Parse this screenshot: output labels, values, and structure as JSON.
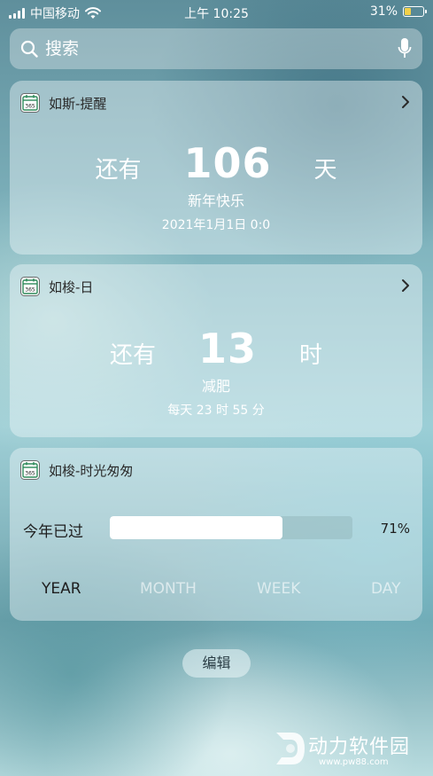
{
  "status_bar": {
    "carrier": "中国移动",
    "time": "上午 10:25",
    "battery_percent": "31%",
    "battery_level": 0.31,
    "icons": [
      "signal-icon",
      "wifi-icon",
      "battery-charging-icon"
    ]
  },
  "search": {
    "placeholder": "搜索",
    "icons": [
      "search-icon",
      "mic-icon"
    ]
  },
  "widgets": [
    {
      "title": "如斯-提醒",
      "icon": "calendar-365-icon",
      "has_chevron": true,
      "prefix": "还有",
      "number": "106",
      "unit": "天",
      "event": "新年快乐",
      "date": "2021年1月1日 0:0"
    },
    {
      "title": "如梭-日",
      "icon": "calendar-365-icon",
      "has_chevron": true,
      "prefix": "还有",
      "number": "13",
      "unit": "时",
      "event": "减肥",
      "date": "每天 23 时 55 分"
    },
    {
      "title": "如梭-时光匆匆",
      "icon": "calendar-365-icon",
      "progress_label": "今年已过",
      "progress_percent": "71%",
      "progress_value": 0.71,
      "tabs": [
        {
          "label": "YEAR",
          "active": true
        },
        {
          "label": "MONTH",
          "active": false
        },
        {
          "label": "WEEK",
          "active": false
        },
        {
          "label": "DAY",
          "active": false
        }
      ]
    }
  ],
  "edit_button": "编辑",
  "watermark": {
    "title": "动力软件园",
    "url": "www.pw88.com"
  },
  "colors": {
    "text_dark": "#1e1e1e",
    "text_light": "#ffffff",
    "battery_charge": "#f2d04a"
  }
}
